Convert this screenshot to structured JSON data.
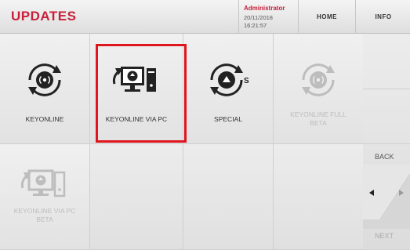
{
  "header": {
    "title": "UPDATES",
    "user": "Administrator",
    "date": "20/11/2018",
    "time": "16:21:57",
    "home_label": "HOME",
    "info_label": "INFO"
  },
  "tiles": [
    {
      "label": "KEYONLINE",
      "enabled": true,
      "icon": "keyonline-icon"
    },
    {
      "label": "KEYONLINE VIA PC",
      "enabled": true,
      "selected": true,
      "icon": "keyonline-via-pc-icon"
    },
    {
      "label": "SPECIAL",
      "enabled": true,
      "icon": "special-update-icon"
    },
    {
      "label_lines": [
        "KEYONLINE FULL",
        "BETA"
      ],
      "enabled": false,
      "icon": "keyonline-full-beta-icon"
    },
    {
      "label_lines": [
        "KEYONLINE VIA PC",
        "BETA"
      ],
      "enabled": false,
      "icon": "keyonline-via-pc-beta-icon"
    }
  ],
  "navigation": {
    "back_label": "BACK",
    "next_label": "NEXT"
  },
  "colors": {
    "accent": "#c7203a",
    "highlight_box": "#e0161f"
  }
}
